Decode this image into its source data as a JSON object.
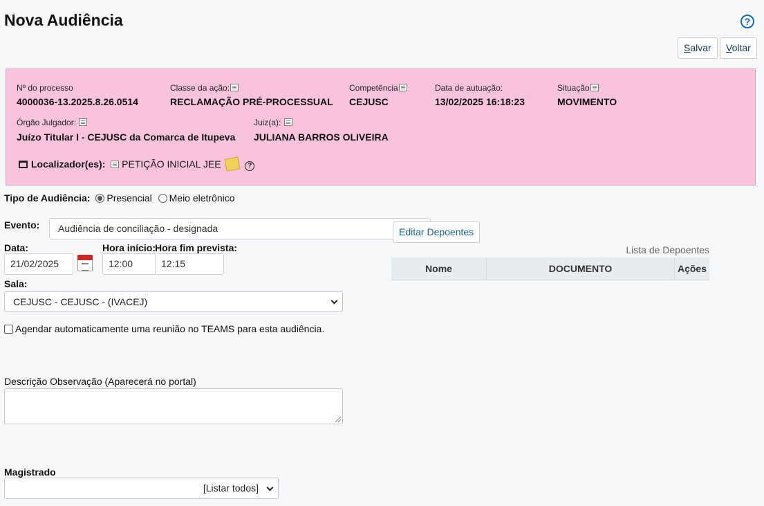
{
  "page": {
    "title": "Nova Audiência",
    "help_icon": "question-circle-icon"
  },
  "toolbar": {
    "save_key": "S",
    "save_rest": "alvar",
    "back_key": "V",
    "back_rest": "oltar"
  },
  "process_panel": {
    "background": "#f9c3de",
    "process_number": {
      "label": "Nº do processo",
      "value": "4000036-13.2025.8.26.0514"
    },
    "action_class": {
      "label": "Classe da ação:",
      "value": "RECLAMAÇÃO PRÉ-PROCESSUAL"
    },
    "competence": {
      "label": "Competência",
      "value": "CEJUSC"
    },
    "filing_date": {
      "label": "Data de autuação:",
      "value": "13/02/2025 16:18:23"
    },
    "status": {
      "label": "Situação",
      "value": "MOVIMENTO"
    },
    "court_body": {
      "label": "Órgão Julgador:",
      "value": "Juízo Titular I - CEJUSC da Comarca de Itupeva"
    },
    "judge": {
      "label": "Juiz(a):",
      "value": "JULIANA BARROS OLIVEIRA"
    },
    "locators": {
      "label": "Localizador(es):",
      "value": "PETIÇÃO INICIAL JEE"
    }
  },
  "form": {
    "hearing_type": {
      "label": "Tipo de Audiência:",
      "options": [
        "Presencial",
        "Meio eletrônico"
      ],
      "selected": "Presencial"
    },
    "event": {
      "label": "Evento:",
      "value": "Audiência de conciliação - designada"
    },
    "edit_deponents_button": "Editar Depoentes",
    "date": {
      "label": "Data:",
      "value": "21/02/2025"
    },
    "start_time": {
      "label": "Hora início:",
      "value": "12:00"
    },
    "end_time": {
      "label": "Hora fim prevista:",
      "value": "12:15"
    },
    "room": {
      "label": "Sala:",
      "value": "CEJUSC - CEJUSC - (IVACEJ)"
    },
    "teams_checkbox": {
      "label": "Agendar automaticamente uma reunião no TEAMS para esta audiência.",
      "checked": false
    },
    "description": {
      "label": "Descrição Observação (Aparecerá no portal)",
      "value": ""
    },
    "magistrate": {
      "label": "Magistrado",
      "value": "[Listar todos]"
    }
  },
  "deponents_table": {
    "caption": "Lista de Depoentes",
    "columns": [
      "Nome",
      "DOCUMENTO",
      "Ações"
    ],
    "rows": []
  }
}
